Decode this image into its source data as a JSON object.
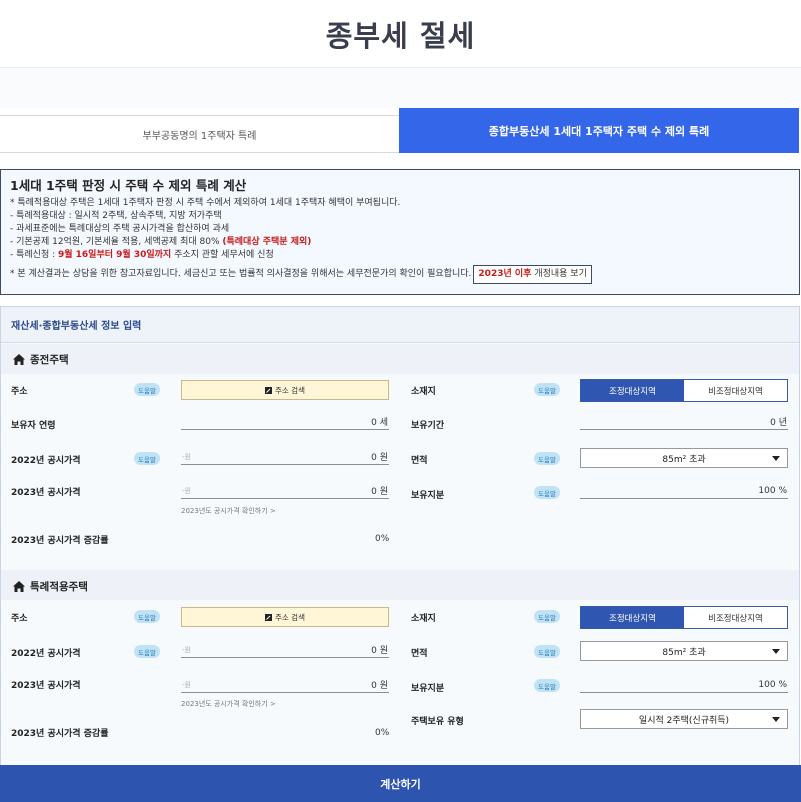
{
  "header": {
    "title": "종부세 절세"
  },
  "tabs": [
    {
      "label": "부부공동명의 1주택자 특례"
    },
    {
      "label": "종합부동산세 1세대 1주택자 주택 수 제외 특례"
    }
  ],
  "info": {
    "title": "1세대 1주택 판정 시 주택 수 제외 특례 계산",
    "line1": "* 특례적용대상 주택은 1세대 1주택자 판정 시 주택 수에서 제외하여 1세대 1주택자 혜택이 부여됩니다.",
    "line2": "- 특례적용대상 : 일시적 2주택, 상속주택, 지방 저가주택",
    "line3": "- 과세표준에는 특례대상의 주택 공시가격을 합산하여 과세",
    "line4_a": "- 기본공제 12억원, 기본세율 적용, 세액공제 최대 80% ",
    "line4_b": "(특례대상 주택분 제외)",
    "line5_a": "- 특례신청 : ",
    "line5_b": "9월 16일부터 9월 30일까지",
    "line5_c": " 주소지 관할 세무서에 신청",
    "line6": "* 본 계산결과는 상담을 위한 참고자료입니다. 세금신고 또는 법률적 의사결정을 위해서는 세무전문가의 확인이 필요합니다.",
    "btn_red": "2023년 이후",
    "btn_rest": " 개정내용 보기"
  },
  "form": {
    "title": "재산세·종합부동산세 정보 입력",
    "help": "도움말",
    "section1": {
      "title": "종전주택",
      "address_label": "주소",
      "address_btn": "주소 검색",
      "location_label": "소재지",
      "loc_on": "조정대상지역",
      "loc_off": "비조정대상지역",
      "age_label": "보유자 연령",
      "age_value": "0 세",
      "period_label": "보유기간",
      "period_value": "0 년",
      "price2022_label": "2022년 공시가격",
      "price_placeholder": "-원",
      "price_value": "0 원",
      "area_label": "면적",
      "area_value": "85m² 초과",
      "price2023_label": "2023년 공시가격",
      "share_label": "보유지분",
      "share_value": "100 %",
      "check_link": "2023년도 공시가격 확인하기 >",
      "rate_label": "2023년 공시가격 증감률",
      "rate_value": "0%"
    },
    "section2": {
      "title": "특례적용주택",
      "address_label": "주소",
      "address_btn": "주소 검색",
      "location_label": "소재지",
      "loc_on": "조정대상지역",
      "loc_off": "비조정대상지역",
      "price2022_label": "2022년 공시가격",
      "price_placeholder": "-원",
      "price_value": "0 원",
      "area_label": "면적",
      "area_value": "85m² 초과",
      "price2023_label": "2023년 공시가격",
      "share_label": "보유지분",
      "share_value": "100 %",
      "check_link": "2023년도 공시가격 확인하기 >",
      "type_label": "주택보유 유형",
      "type_value": "일시적 2주택(신규취득)",
      "rate_label": "2023년 공시가격 증감률",
      "rate_value": "0%"
    }
  },
  "calc_button": "계산하기"
}
